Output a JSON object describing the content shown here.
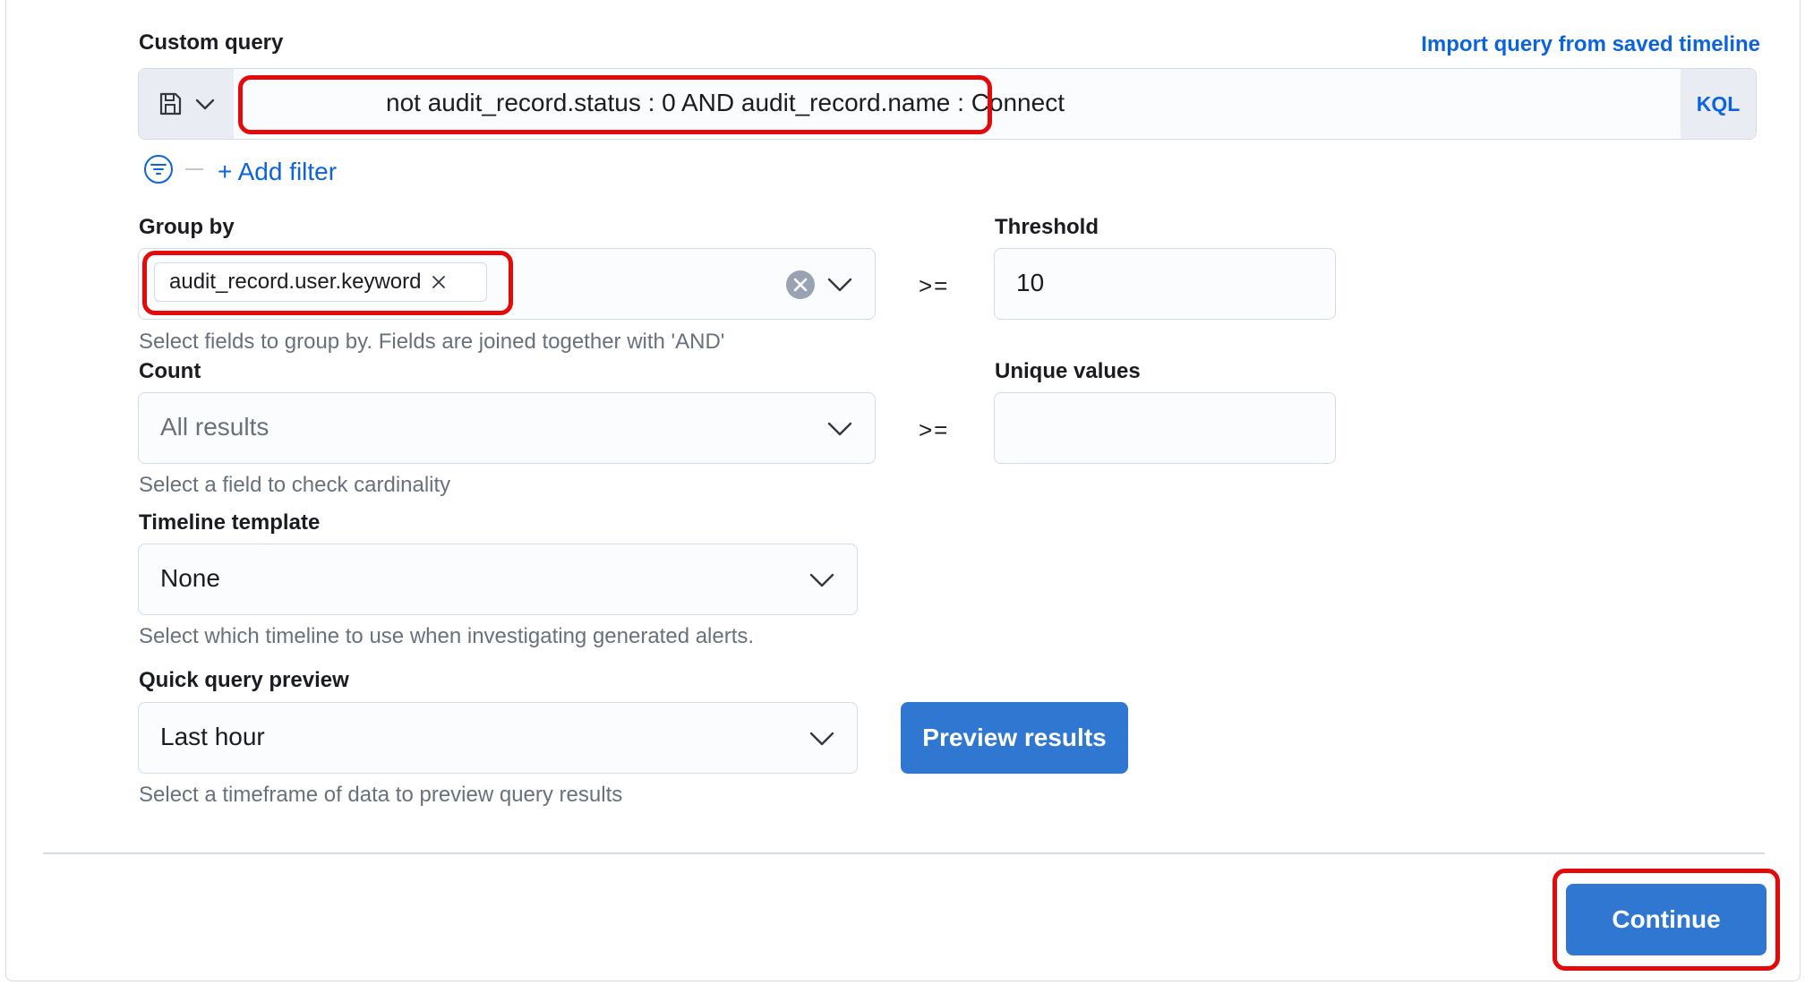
{
  "custom_query": {
    "label": "Custom query",
    "import_link": "Import query from saved timeline",
    "query_text": "not audit_record.status : 0 AND audit_record.name : Connect",
    "language": "KQL",
    "add_filter": "+ Add filter"
  },
  "group_by": {
    "label": "Group by",
    "selected_field": "audit_record.user.keyword",
    "help": "Select fields to group by. Fields are joined together with 'AND'"
  },
  "threshold": {
    "label": "Threshold",
    "operator": ">=",
    "value": "10"
  },
  "count": {
    "label": "Count",
    "placeholder": "All results",
    "help": "Select a field to check cardinality"
  },
  "unique_values": {
    "label": "Unique values",
    "operator": ">=",
    "value": ""
  },
  "timeline_template": {
    "label": "Timeline template",
    "selected": "None",
    "help": "Select which timeline to use when investigating generated alerts."
  },
  "quick_query_preview": {
    "label": "Quick query preview",
    "selected": "Last hour",
    "preview_button": "Preview results",
    "help": "Select a timeframe of data to preview query results"
  },
  "footer": {
    "continue_button": "Continue"
  },
  "colors": {
    "accent": "#0b64dd",
    "primary_button": "#2f77d1",
    "highlight": "#e40a0a",
    "field_bg": "#fbfcfd",
    "border": "#d5dbe5"
  },
  "icons": {
    "save_query": "save-icon",
    "menu": "chevron-down-icon",
    "filter": "filter-icon",
    "clear": "clear-icon",
    "remove": "close-icon"
  }
}
